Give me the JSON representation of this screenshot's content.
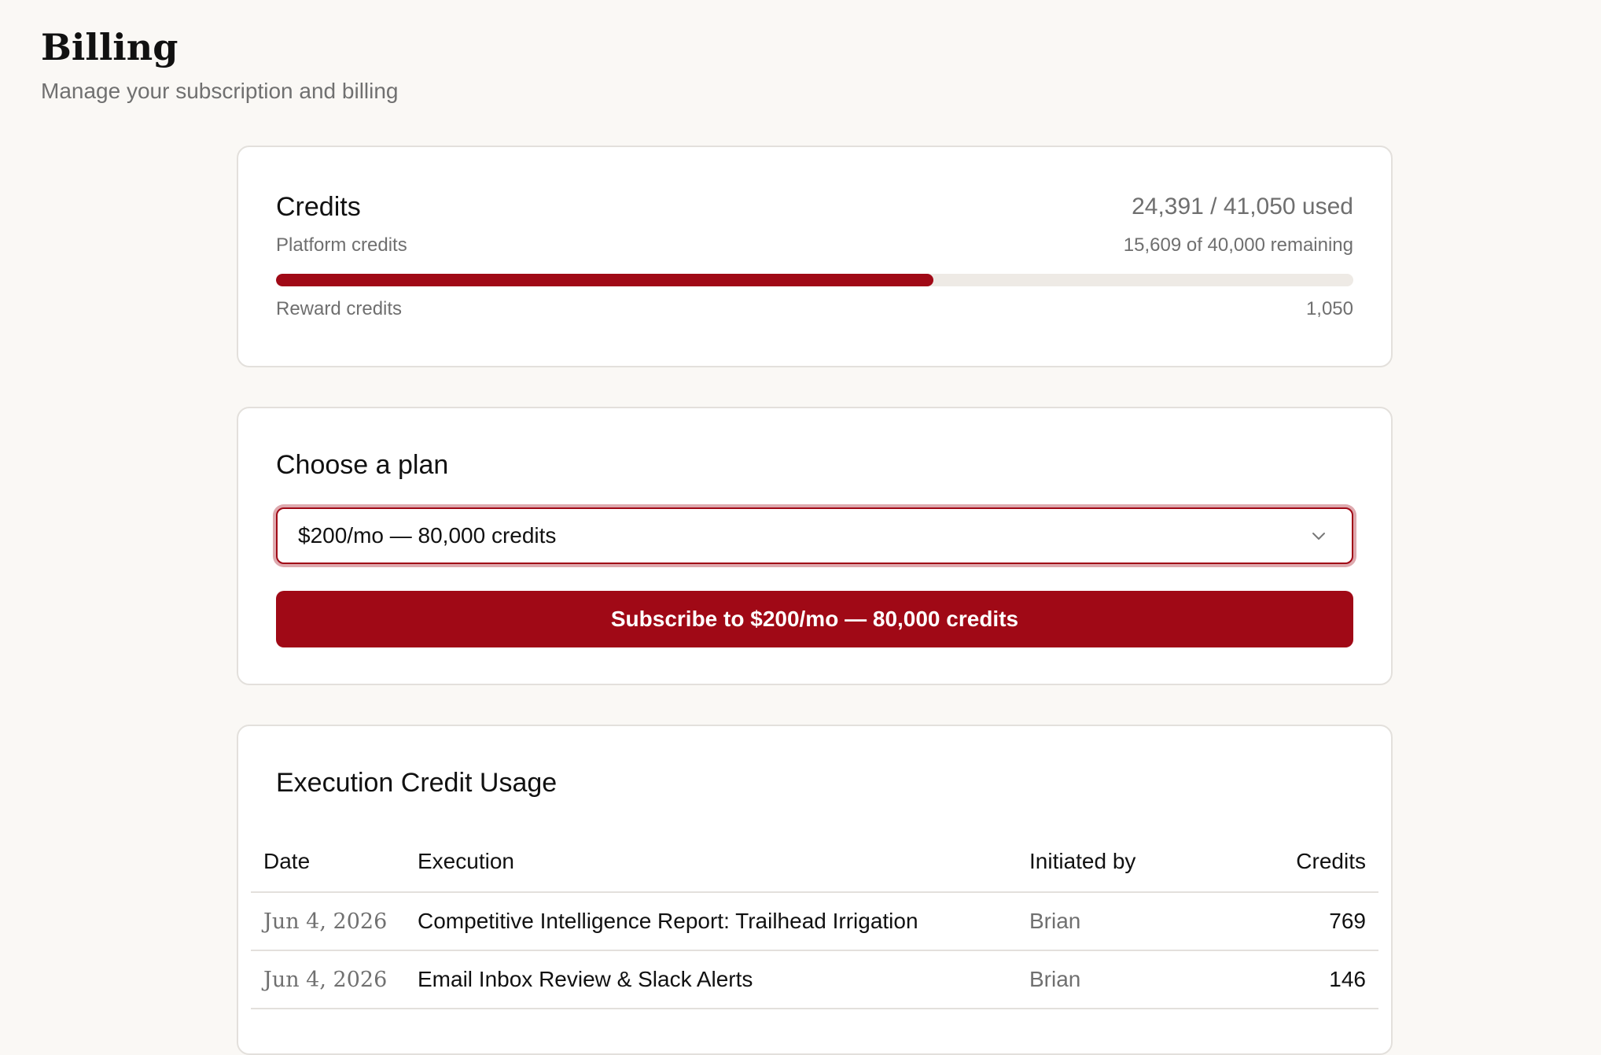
{
  "header": {
    "title": "Billing",
    "subtitle": "Manage your subscription and billing"
  },
  "credits": {
    "title": "Credits",
    "used_summary": "24,391 / 41,050 used",
    "platform_label": "Platform credits",
    "platform_remaining": "15,609 of 40,000 remaining",
    "platform_used_fraction": 0.61,
    "reward_label": "Reward credits",
    "reward_value": "1,050",
    "accent_color": "#a00916"
  },
  "plan": {
    "title": "Choose a plan",
    "selected_option": "$200/mo — 80,000 credits",
    "subscribe_label": "Subscribe to $200/mo — 80,000 credits"
  },
  "usage": {
    "title": "Execution Credit Usage",
    "columns": [
      "Date",
      "Execution",
      "Initiated by",
      "Credits"
    ],
    "rows": [
      {
        "date": "Jun 4, 2026",
        "execution": "Competitive Intelligence Report: Trailhead Irrigation",
        "initiated_by": "Brian",
        "credits": "769"
      },
      {
        "date": "Jun 4, 2026",
        "execution": "Email Inbox Review & Slack Alerts",
        "initiated_by": "Brian",
        "credits": "146"
      }
    ]
  }
}
